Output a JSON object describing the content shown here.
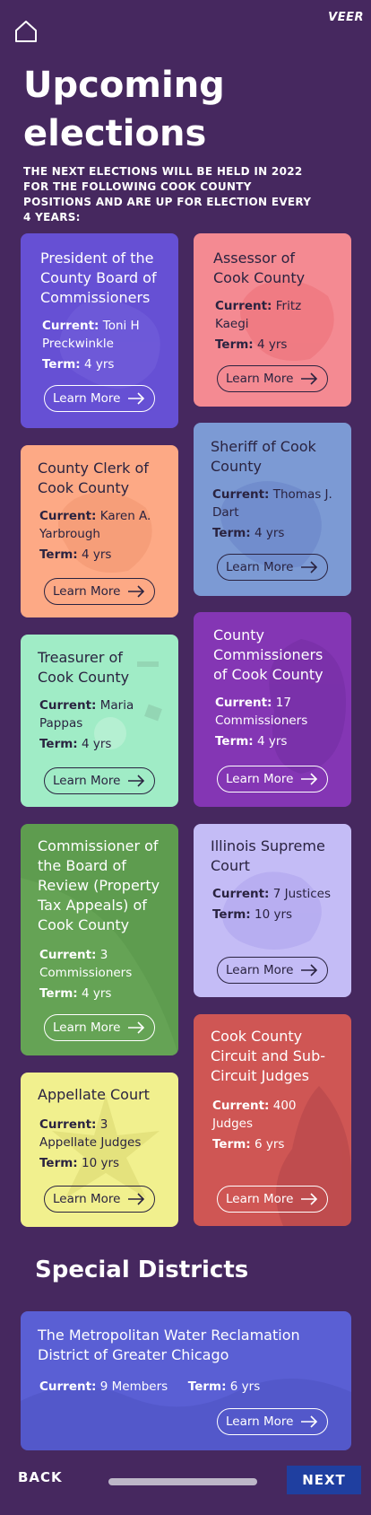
{
  "brand": "VEER",
  "header": {
    "title_line1": "Upcoming",
    "title_line2": "elections",
    "subtitle": "THE NEXT ELECTIONS WILL BE HELD IN 2022 FOR THE FOLLOWING COOK COUNTY POSITIONS AND ARE UP FOR ELECTION EVERY 4 YEARS:"
  },
  "labels": {
    "current": "Current:",
    "term": "Term:",
    "learn_more": "Learn More"
  },
  "cards": [
    {
      "title": "President of the County Board of Commissioners",
      "current": "Toni H Preckwinkle",
      "term": "4 yrs",
      "color": "#6650d4"
    },
    {
      "title": "Assessor of Cook County",
      "current": "Fritz Kaegi",
      "term": "4 yrs",
      "color": "#f48a92"
    },
    {
      "title": "Sheriff of Cook County",
      "current": "Thomas J. Dart",
      "term": "4 yrs",
      "color": "#7c9ad4"
    },
    {
      "title": "County Clerk of Cook County",
      "current": "Karen A. Yarbrough",
      "term": "4 yrs",
      "color": "#fda985"
    },
    {
      "title": "County Commissioners of Cook County",
      "current": "17 Commissioners",
      "term": "4 yrs",
      "color": "#8436b4"
    },
    {
      "title": "Treasurer of Cook County",
      "current": "Maria Pappas",
      "term": "4 yrs",
      "color": "#a0ecc6"
    },
    {
      "title": "Illinois Supreme Court",
      "current": "7 Justices",
      "term": "10 yrs",
      "color": "#c4bcf6"
    },
    {
      "title": "Commissioner of the Board of Review (Property Tax Appeals) of Cook County",
      "current": "3 Commissioners",
      "term": "4 yrs",
      "color": "#5e9c4f"
    },
    {
      "title": "Cook County Circuit and Sub-Circuit Judges",
      "current": "400 Judges",
      "term": "6 yrs",
      "color": "#cf5654"
    },
    {
      "title": "Appellate Court",
      "current": "3 Appellate Judges",
      "term": "10 yrs",
      "color": "#f1f08e"
    }
  ],
  "special_districts": {
    "title": "Special Districts",
    "card": {
      "title": "The Metropolitan Water Reclamation District of Greater Chicago",
      "current": "9 Members",
      "term": "6 yrs",
      "color": "#5a5fd4"
    }
  },
  "footer": {
    "back_label": "BACK",
    "next_label": "NEXT"
  }
}
